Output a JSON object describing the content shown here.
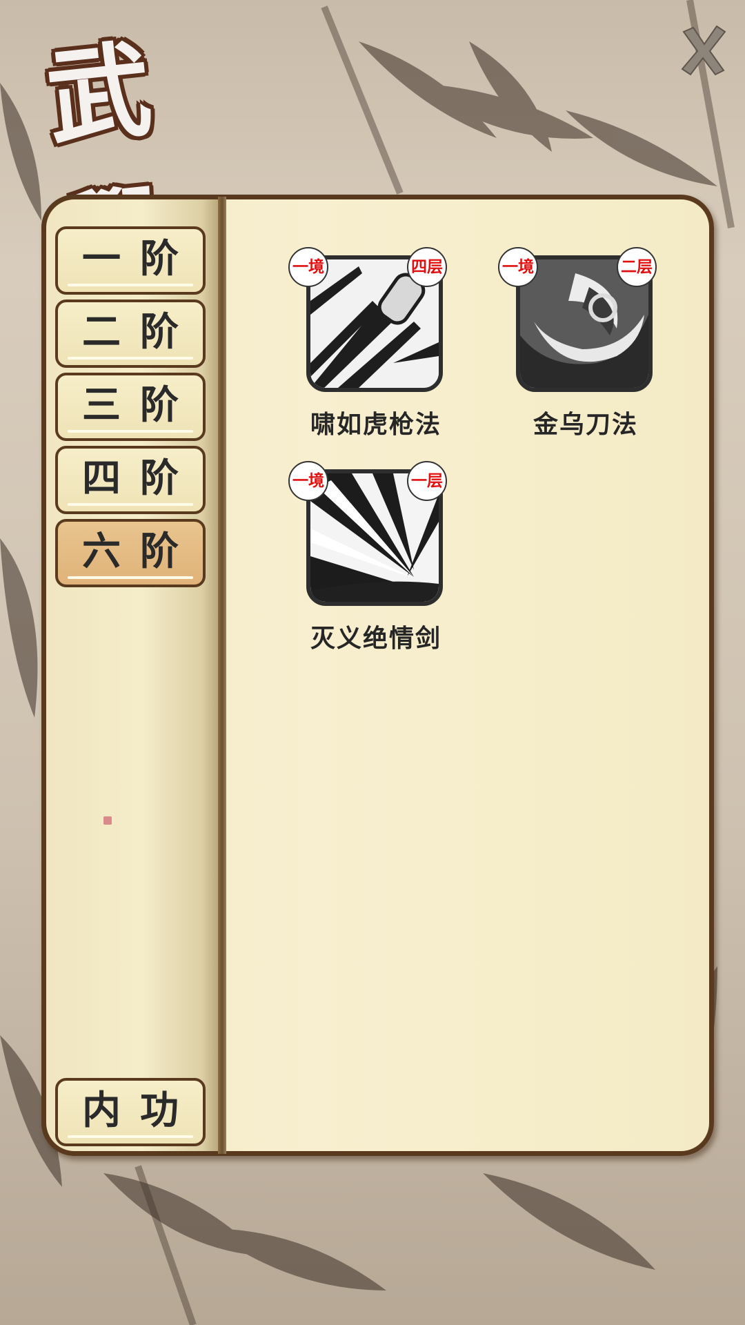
{
  "title": "武學",
  "close": {
    "icon": "close-icon"
  },
  "tiers": [
    {
      "label": "一阶",
      "active": false
    },
    {
      "label": "二阶",
      "active": false
    },
    {
      "label": "三阶",
      "active": false
    },
    {
      "label": "四阶",
      "active": false
    },
    {
      "label": "六阶",
      "active": true
    }
  ],
  "neigong": {
    "label": "内功"
  },
  "skills": [
    {
      "name": "啸如虎枪法",
      "realm": "一境",
      "level": "四层",
      "icon": "spear-strike-icon"
    },
    {
      "name": "金乌刀法",
      "realm": "一境",
      "level": "二层",
      "icon": "blade-swirl-icon"
    },
    {
      "name": "灭义绝情剑",
      "realm": "一境",
      "level": "一层",
      "icon": "sword-burst-icon"
    }
  ],
  "colors": {
    "badge_text": "#e01010",
    "active_tab": "#e4bb83",
    "frame": "#5a3a1e"
  }
}
